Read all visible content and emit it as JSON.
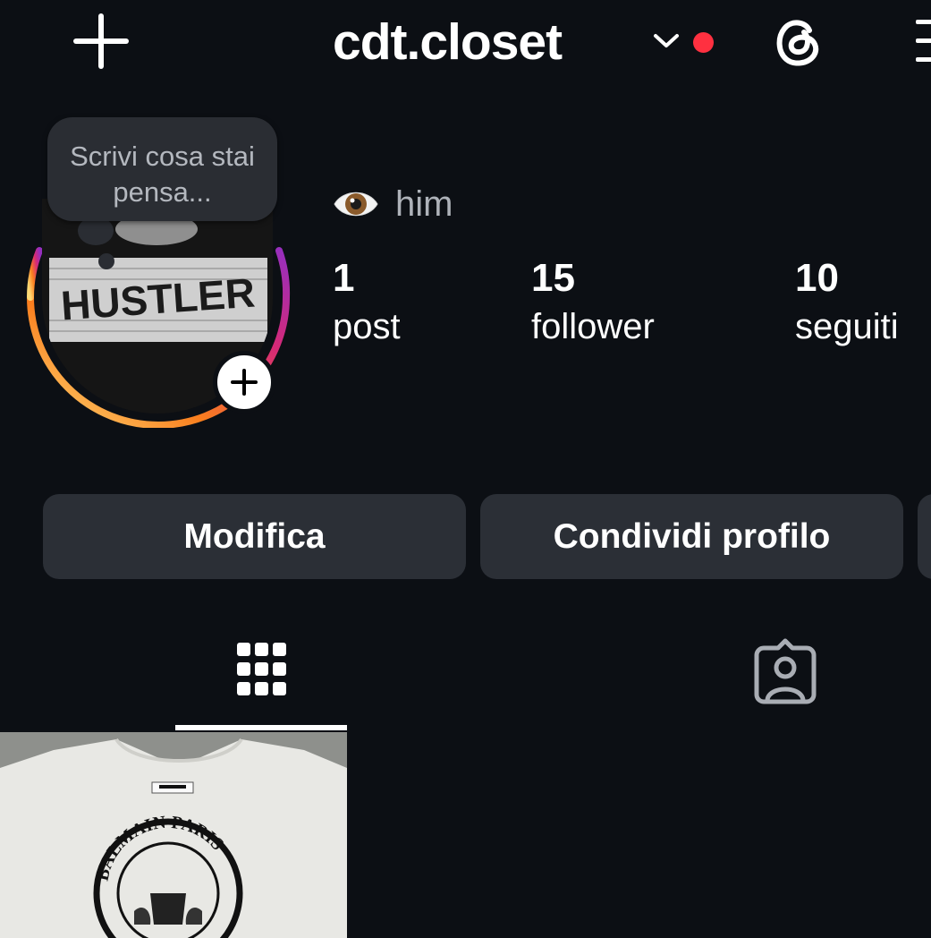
{
  "header": {
    "username": "cdt.closet",
    "plus_icon": "plus-icon",
    "dropdown_icon": "chevron-down-icon",
    "notification_color": "#ff3040",
    "threads_icon": "threads-icon",
    "menu_icon": "hamburger-menu-icon"
  },
  "note": {
    "placeholder": "Scrivi cosa stai pensa..."
  },
  "avatar": {
    "print_text": "HUSTLER",
    "ring_colors": [
      "#feda75",
      "#fa7e1e",
      "#d62976",
      "#962fbf"
    ],
    "add_icon": "plus-icon"
  },
  "bio": {
    "emoji": "👁️",
    "text": "him"
  },
  "stats": [
    {
      "value": "1",
      "label": "post"
    },
    {
      "value": "15",
      "label": "follower"
    },
    {
      "value": "10",
      "label": "seguiti"
    }
  ],
  "actions": {
    "edit_label": "Modifica",
    "share_label": "Condividi profilo"
  },
  "tabs": [
    {
      "icon": "grid-icon",
      "selected": true
    },
    {
      "icon": "tagged-person-icon",
      "selected": false
    }
  ],
  "posts": [
    {
      "thumbnail_text": "BALMAIN PARIS"
    }
  ]
}
